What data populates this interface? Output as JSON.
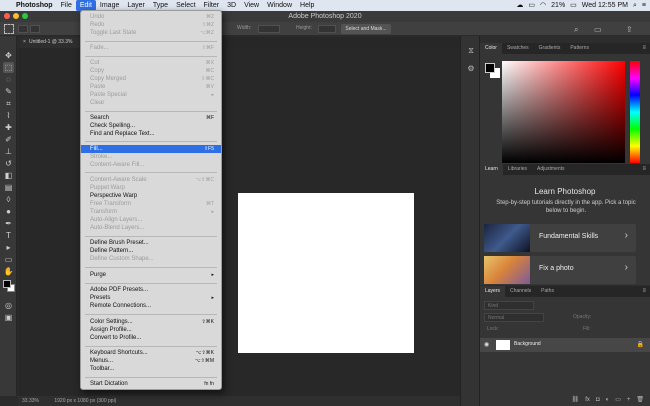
{
  "menubar": {
    "app": "Photoshop",
    "items": [
      "File",
      "Edit",
      "Image",
      "Layer",
      "Type",
      "Select",
      "Filter",
      "3D",
      "View",
      "Window",
      "Help"
    ],
    "battery": "21%",
    "clock": "Wed 12:55 PM"
  },
  "window": {
    "title": "Adobe Photoshop 2020"
  },
  "options": {
    "width_label": "Width:",
    "height_label": "Height:",
    "select_mask": "Select and Mask..."
  },
  "document": {
    "tab_label": "Untitled-1 @ 33.3%"
  },
  "status": {
    "zoom": "33.33%",
    "size": "1920 px x 1080 px (300 ppi)"
  },
  "color_panel": {
    "tabs": [
      "Color",
      "Swatches",
      "Gradients",
      "Patterns"
    ]
  },
  "learn_panel": {
    "tabs": [
      "Learn",
      "Libraries",
      "Adjustments"
    ],
    "title": "Learn Photoshop",
    "description": "Step-by-step tutorials directly in the app. Pick a topic below to begin.",
    "cards": [
      "Fundamental Skills",
      "Fix a photo"
    ]
  },
  "layers_panel": {
    "tabs": [
      "Layers",
      "Channels",
      "Paths"
    ],
    "kind_placeholder": "Kind",
    "blend": "Normal",
    "opacity_label": "Opacity:",
    "lock_label": "Lock:",
    "fill_label": "Fill:",
    "layer_name": "Background"
  },
  "edit_menu": {
    "items": [
      {
        "label": "Undo",
        "shortcut": "⌘Z",
        "disabled": true
      },
      {
        "label": "Redo",
        "shortcut": "⇧⌘Z",
        "disabled": true
      },
      {
        "label": "Toggle Last State",
        "shortcut": "⌥⌘Z",
        "disabled": true
      },
      {
        "label": "Fade...",
        "shortcut": "⇧⌘F",
        "disabled": true
      },
      {
        "label": "Cut",
        "shortcut": "⌘X",
        "disabled": true
      },
      {
        "label": "Copy",
        "shortcut": "⌘C",
        "disabled": true
      },
      {
        "label": "Copy Merged",
        "shortcut": "⇧⌘C",
        "disabled": true
      },
      {
        "label": "Paste",
        "shortcut": "⌘V",
        "disabled": true
      },
      {
        "label": "Paste Special",
        "shortcut": "▸",
        "disabled": true
      },
      {
        "label": "Clear",
        "shortcut": "",
        "disabled": true
      },
      {
        "label": "Search",
        "shortcut": "⌘F",
        "disabled": false
      },
      {
        "label": "Check Spelling...",
        "shortcut": "",
        "disabled": false
      },
      {
        "label": "Find and Replace Text...",
        "shortcut": "",
        "disabled": false
      },
      {
        "label": "Fill...",
        "shortcut": "⇧F5",
        "disabled": false,
        "highlighted": true
      },
      {
        "label": "Stroke...",
        "shortcut": "",
        "disabled": true
      },
      {
        "label": "Content-Aware Fill...",
        "shortcut": "",
        "disabled": true
      },
      {
        "label": "Content-Aware Scale",
        "shortcut": "⌥⇧⌘C",
        "disabled": true
      },
      {
        "label": "Puppet Warp",
        "shortcut": "",
        "disabled": true
      },
      {
        "label": "Perspective Warp",
        "shortcut": "",
        "disabled": false
      },
      {
        "label": "Free Transform",
        "shortcut": "⌘T",
        "disabled": true
      },
      {
        "label": "Transform",
        "shortcut": "▸",
        "disabled": true
      },
      {
        "label": "Auto-Align Layers...",
        "shortcut": "",
        "disabled": true
      },
      {
        "label": "Auto-Blend Layers...",
        "shortcut": "",
        "disabled": true
      },
      {
        "label": "Define Brush Preset...",
        "shortcut": "",
        "disabled": false
      },
      {
        "label": "Define Pattern...",
        "shortcut": "",
        "disabled": false
      },
      {
        "label": "Define Custom Shape...",
        "shortcut": "",
        "disabled": true
      },
      {
        "label": "Purge",
        "shortcut": "▸",
        "disabled": false
      },
      {
        "label": "Adobe PDF Presets...",
        "shortcut": "",
        "disabled": false
      },
      {
        "label": "Presets",
        "shortcut": "▸",
        "disabled": false
      },
      {
        "label": "Remote Connections...",
        "shortcut": "",
        "disabled": false
      },
      {
        "label": "Color Settings...",
        "shortcut": "⇧⌘K",
        "disabled": false
      },
      {
        "label": "Assign Profile...",
        "shortcut": "",
        "disabled": false
      },
      {
        "label": "Convert to Profile...",
        "shortcut": "",
        "disabled": false
      },
      {
        "label": "Keyboard Shortcuts...",
        "shortcut": "⌥⇧⌘K",
        "disabled": false
      },
      {
        "label": "Menus...",
        "shortcut": "⌥⇧⌘M",
        "disabled": false
      },
      {
        "label": "Toolbar...",
        "shortcut": "",
        "disabled": false
      },
      {
        "label": "Start Dictation",
        "shortcut": "fn fn",
        "disabled": false
      }
    ]
  },
  "colors": {
    "accent": "#2f6fe6"
  }
}
